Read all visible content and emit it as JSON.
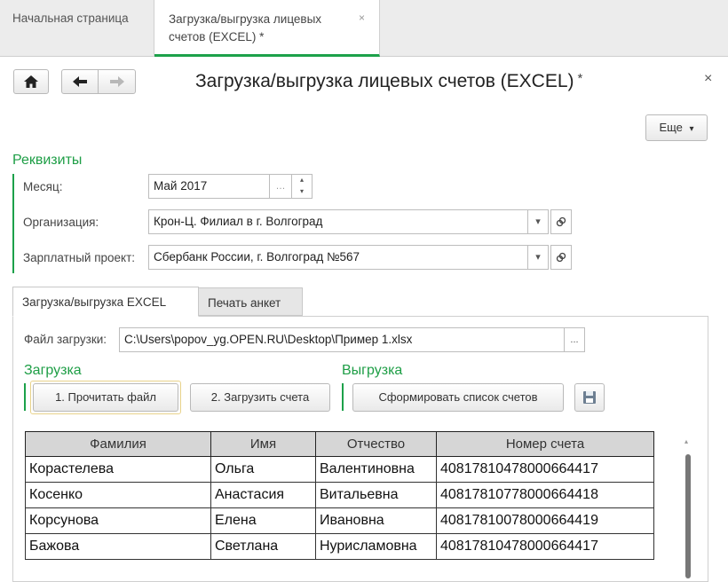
{
  "tabs": {
    "home": "Начальная страница",
    "active_line1": "Загрузка/выгрузка лицевых",
    "active_line2": "счетов (EXCEL) *",
    "close": "×"
  },
  "header": {
    "title": "Загрузка/выгрузка лицевых счетов (EXCEL)",
    "modified_mark": "*",
    "close": "×",
    "more_label": "Еще",
    "more_arrow": "▾"
  },
  "requisites": {
    "title": "Реквизиты",
    "month_label": "Месяц:",
    "month_value": "Май 2017",
    "org_label": "Организация:",
    "org_value": "Крон-Ц. Филиал в г. Волгоград",
    "project_label": "Зарплатный проект:",
    "project_value": "Сбербанк России, г. Волгоград №567"
  },
  "inner_tabs": {
    "excel": "Загрузка/выгрузка EXCEL",
    "print": "Печать анкет"
  },
  "excel": {
    "file_label": "Файл загрузки:",
    "file_value": "C:\\Users\\popov_yg.OPEN.RU\\Desktop\\Пример 1.xlsx",
    "browse": "...",
    "load_title": "Загрузка",
    "read_button": "1. Прочитать файл",
    "load_button": "2. Загрузить счета",
    "unload_title": "Выгрузка",
    "form_button": "Сформировать список счетов"
  },
  "table": {
    "columns": [
      "Фамилия",
      "Имя",
      "Отчество",
      "Номер счета"
    ],
    "rows": [
      [
        "Корастелева",
        "Ольга",
        "Валентиновна",
        "40817810478000664417"
      ],
      [
        "Косенко",
        "Анастасия",
        "Витальевна",
        "40817810778000664418"
      ],
      [
        "Корсунова",
        "Елена",
        "Ивановна",
        "40817810078000664419"
      ],
      [
        "Бажова",
        "Светлана",
        "Нурисламовна",
        "40817810478000664417"
      ]
    ]
  }
}
